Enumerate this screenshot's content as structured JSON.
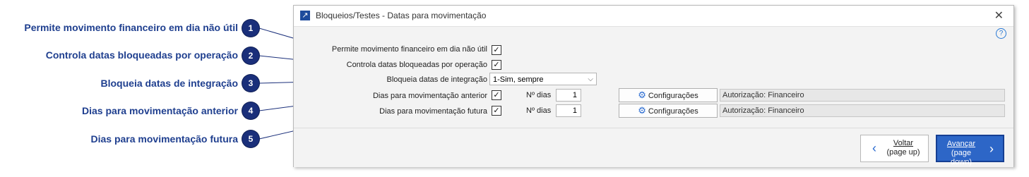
{
  "callouts": [
    {
      "number": "1",
      "label": "Permite movimento financeiro em dia não útil"
    },
    {
      "number": "2",
      "label": "Controla datas bloqueadas por operação"
    },
    {
      "number": "3",
      "label": "Bloqueia datas de integração"
    },
    {
      "number": "4",
      "label": "Dias para movimentação anterior"
    },
    {
      "number": "5",
      "label": "Dias para movimentação futura"
    }
  ],
  "window": {
    "title": "Bloqueios/Testes - Datas para movimentação",
    "close_glyph": "✕",
    "help_glyph": "?"
  },
  "form": {
    "allow_nonbusiness_label": "Permite movimento financeiro em dia não útil",
    "allow_nonbusiness_checked": true,
    "control_blocked_label": "Controla datas bloqueadas por operação",
    "control_blocked_checked": true,
    "block_integration_label": "Bloqueia datas de integração",
    "block_integration_value": "1-Sim, sempre",
    "days_before_label": "Dias para movimentação anterior",
    "days_before_checked": true,
    "days_before_count_label": "Nº dias",
    "days_before_count": "1",
    "days_before_config_label": "Configurações",
    "days_before_auth": "Autorização: Financeiro",
    "days_after_label": "Dias para movimentação futura",
    "days_after_checked": true,
    "days_after_count_label": "Nº dias",
    "days_after_count": "1",
    "days_after_config_label": "Configurações",
    "days_after_auth": "Autorização: Financeiro"
  },
  "footer": {
    "back_label": "Voltar",
    "back_sub": "(page up)",
    "next_label": "Avançar",
    "next_sub": "(page down)"
  },
  "icons": {
    "checkmark": "✓",
    "chevron_down": "⌵",
    "gear": "⚙",
    "arrow_left": "‹",
    "arrow_right": "›"
  },
  "colors": {
    "callout_text": "#1f3f8f",
    "badge": "#1a2f7a",
    "primary_button": "#2d66c7"
  }
}
